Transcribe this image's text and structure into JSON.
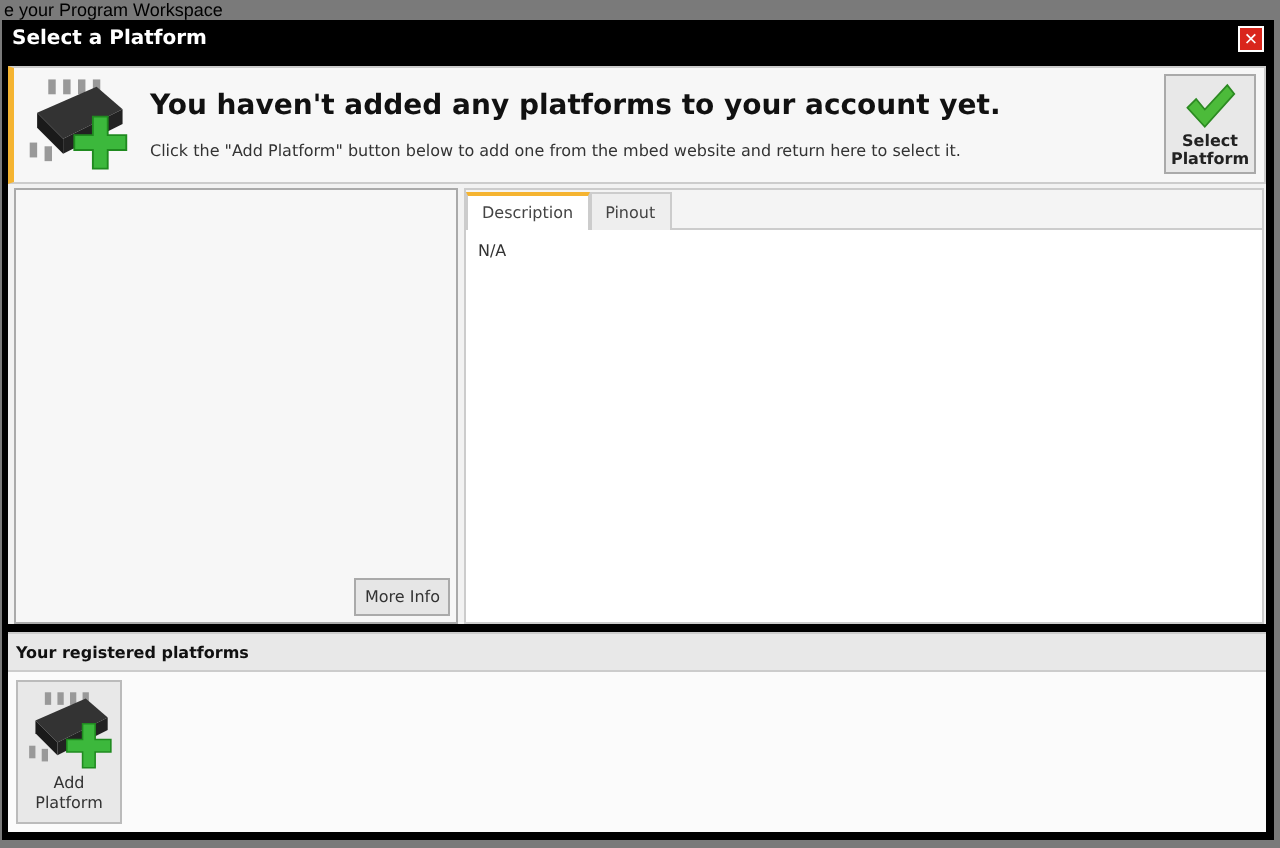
{
  "background_title": "e your Program Workspace",
  "window": {
    "title": "Select a Platform",
    "close": "×"
  },
  "header": {
    "heading": "You haven't added any platforms to your account yet.",
    "message": "Click the \"Add Platform\" button below to add one from the mbed website and return here to select it.",
    "select_button": "Select Platform"
  },
  "details": {
    "more_info_button": "More Info",
    "tabs": [
      {
        "label": "Description",
        "selected": true
      },
      {
        "label": "Pinout",
        "selected": false
      }
    ],
    "content": "N/A"
  },
  "registered": {
    "heading": "Your registered platforms",
    "add_button": "Add Platform"
  }
}
